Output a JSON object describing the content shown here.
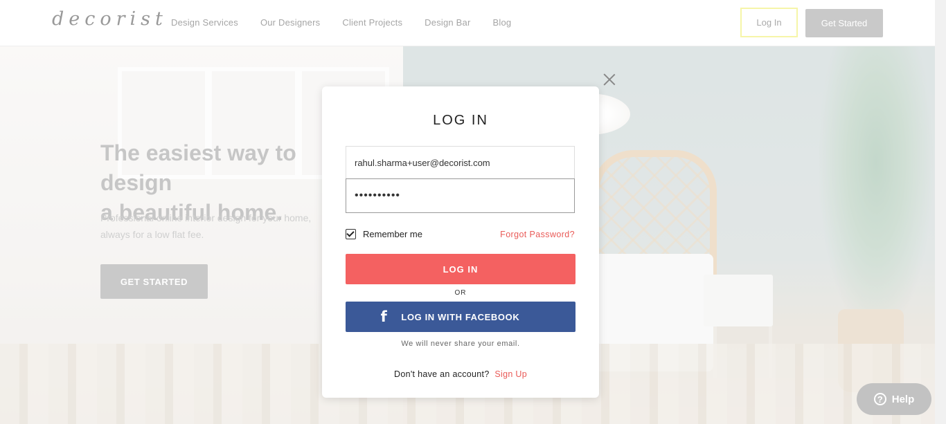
{
  "header": {
    "logo": "decorist",
    "nav": [
      "Design Services",
      "Our Designers",
      "Client Projects",
      "Design Bar",
      "Blog"
    ],
    "login_label": "Log In",
    "get_started_label": "Get Started"
  },
  "hero": {
    "title": "The easiest way to design\na beautiful home.",
    "subtitle": "Professional online interior design for your home,\nalways for a low flat fee.",
    "cta_label": "GET STARTED"
  },
  "modal": {
    "title": "LOG IN",
    "email_value": "rahul.sharma+user@decorist.com",
    "password_value": "••••••••••",
    "remember_label": "Remember me",
    "remember_checked": true,
    "forgot_label": "Forgot Password?",
    "login_button": "LOG IN",
    "or_label": "OR",
    "facebook_button": "LOG IN WITH FACEBOOK",
    "facebook_icon": "f",
    "privacy_note": "We will never share your email.",
    "no_account_text": "Don't have an account?",
    "signup_label": "Sign Up"
  },
  "help": {
    "label": "Help",
    "icon": "?"
  },
  "colors": {
    "accent_red": "#f46161",
    "facebook_blue": "#3b5998",
    "link_red": "#e95a57"
  }
}
